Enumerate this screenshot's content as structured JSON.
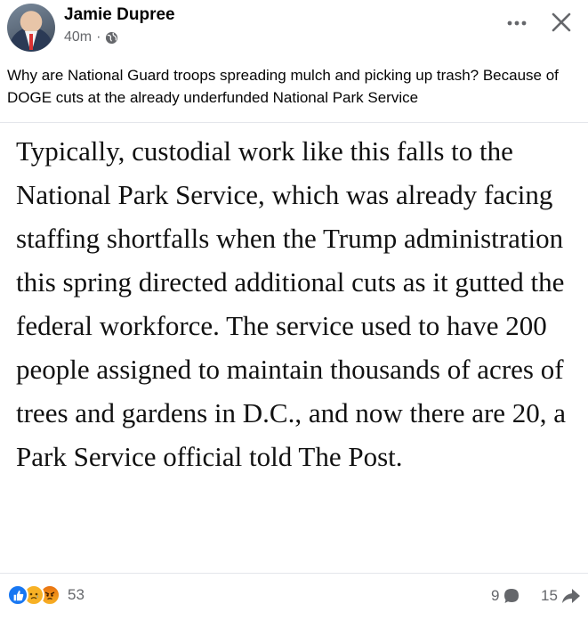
{
  "post": {
    "author": "Jamie Dupree",
    "time": "40m",
    "separator": "·",
    "text": "Why are National Guard troops spreading mulch and picking up trash? Because of DOGE cuts at the already underfunded National Park Service",
    "excerpt": "Typically, custodial work like this falls to the National Park Service, which was already facing staffing shortfalls when the Trump administration this spring directed additional cuts as it gutted the federal workforce. The service used to have 200 people assigned to maintain thousands of acres of trees and gardens in D.C., and now there are 20, a Park Service official told The Post."
  },
  "icons": {
    "privacy": "globe-icon",
    "more": "more-icon",
    "close": "close-icon",
    "comment": "comment-icon",
    "share": "share-icon"
  },
  "stats": {
    "reactions": [
      "like",
      "sad",
      "angry"
    ],
    "reaction_count": "53",
    "comment_count": "9",
    "share_count": "15"
  },
  "colors": {
    "like": "#1877f2",
    "secondary_text": "#65676b"
  }
}
